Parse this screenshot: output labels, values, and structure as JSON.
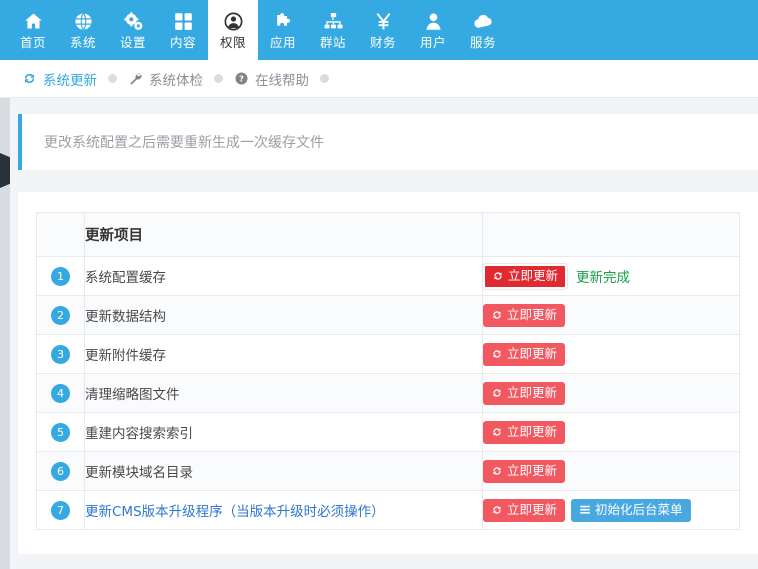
{
  "topnav": {
    "items": [
      {
        "label": "首页",
        "icon": "home-icon",
        "active": false
      },
      {
        "label": "系统",
        "icon": "globe-icon",
        "active": false
      },
      {
        "label": "设置",
        "icon": "gears-icon",
        "active": false
      },
      {
        "label": "内容",
        "icon": "grid-icon",
        "active": false
      },
      {
        "label": "权限",
        "icon": "user-circle-icon",
        "active": true
      },
      {
        "label": "应用",
        "icon": "puzzle-icon",
        "active": false
      },
      {
        "label": "群站",
        "icon": "sitemap-icon",
        "active": false
      },
      {
        "label": "财务",
        "icon": "yen-icon",
        "active": false
      },
      {
        "label": "用户",
        "icon": "user-icon",
        "active": false
      },
      {
        "label": "服务",
        "icon": "cloud-icon",
        "active": false
      }
    ]
  },
  "subnav": {
    "items": [
      {
        "label": "系统更新",
        "icon": "refresh-icon",
        "active": true
      },
      {
        "label": "系统体检",
        "icon": "wrench-icon",
        "active": false
      },
      {
        "label": "在线帮助",
        "icon": "question-circle-icon",
        "active": false
      }
    ]
  },
  "alert": {
    "message": "更改系统配置之后需要重新生成一次缓存文件"
  },
  "table": {
    "headers": [
      "",
      "更新项目",
      ""
    ],
    "rows": [
      {
        "num": "1",
        "name": "系统配置缓存",
        "link": false,
        "buttons": [
          {
            "label": "立即更新",
            "style": "red-focused",
            "icon": "refresh-icon"
          }
        ],
        "status": "更新完成"
      },
      {
        "num": "2",
        "name": "更新数据结构",
        "link": false,
        "buttons": [
          {
            "label": "立即更新",
            "style": "red",
            "icon": "refresh-icon"
          }
        ],
        "status": ""
      },
      {
        "num": "3",
        "name": "更新附件缓存",
        "link": false,
        "buttons": [
          {
            "label": "立即更新",
            "style": "red",
            "icon": "refresh-icon"
          }
        ],
        "status": ""
      },
      {
        "num": "4",
        "name": "清理缩略图文件",
        "link": false,
        "buttons": [
          {
            "label": "立即更新",
            "style": "red",
            "icon": "refresh-icon"
          }
        ],
        "status": ""
      },
      {
        "num": "5",
        "name": "重建内容搜索索引",
        "link": false,
        "buttons": [
          {
            "label": "立即更新",
            "style": "red",
            "icon": "refresh-icon"
          }
        ],
        "status": ""
      },
      {
        "num": "6",
        "name": "更新模块域名目录",
        "link": false,
        "buttons": [
          {
            "label": "立即更新",
            "style": "red",
            "icon": "refresh-icon"
          }
        ],
        "status": ""
      },
      {
        "num": "7",
        "name": "更新CMS版本升级程序（当版本升级时必须操作）",
        "link": true,
        "buttons": [
          {
            "label": "立即更新",
            "style": "red",
            "icon": "refresh-icon"
          },
          {
            "label": "初始化后台菜单",
            "style": "blue",
            "icon": "list-icon"
          }
        ],
        "status": ""
      }
    ]
  },
  "colors": {
    "brand": "#35a9e1",
    "danger": "#f1585f",
    "danger_active": "#e02a32",
    "success": "#18a04a",
    "link": "#2f77d0",
    "page_bg": "#f2f4f7"
  }
}
